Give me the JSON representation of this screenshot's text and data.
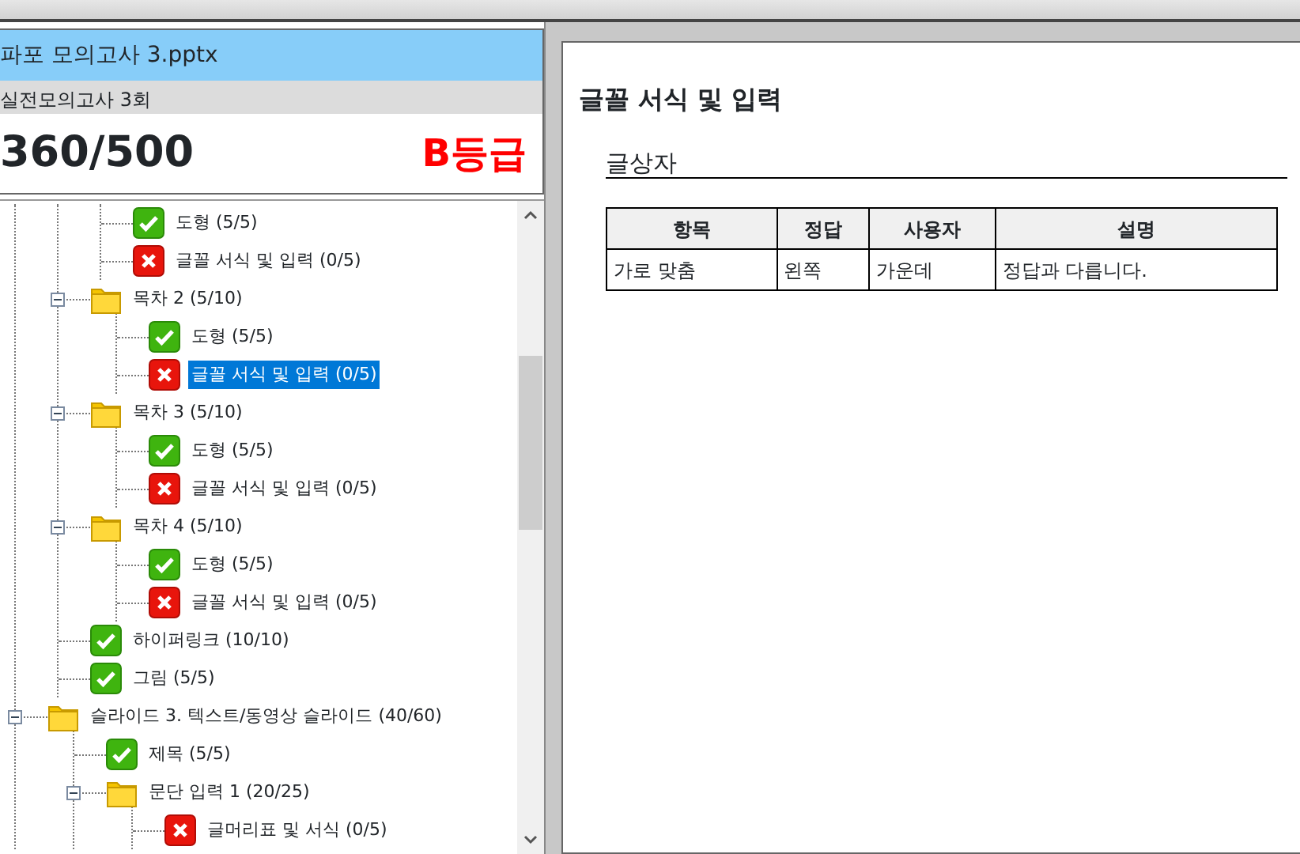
{
  "file": {
    "title": "파포 모의고사 3.pptx",
    "subtitle": "실전모의고사 3회",
    "score": "360/500",
    "grade": "B등급"
  },
  "tree": [
    {
      "kind": "continued",
      "children": [
        {
          "kind": "continued",
          "children": [
            {
              "kind": "pass",
              "label": "도형 (5/5)",
              "selected": false
            },
            {
              "kind": "fail",
              "label": "글꼴 서식 및 입력 (0/5)",
              "selected": false
            }
          ]
        },
        {
          "kind": "folder",
          "label": "목차 2 (5/10)",
          "expanded": true,
          "selected": false,
          "children": [
            {
              "kind": "pass",
              "label": "도형 (5/5)",
              "selected": false
            },
            {
              "kind": "fail",
              "label": "글꼴 서식 및 입력 (0/5)",
              "selected": true
            }
          ]
        },
        {
          "kind": "folder",
          "label": "목차 3 (5/10)",
          "expanded": true,
          "selected": false,
          "children": [
            {
              "kind": "pass",
              "label": "도형 (5/5)",
              "selected": false
            },
            {
              "kind": "fail",
              "label": "글꼴 서식 및 입력 (0/5)",
              "selected": false
            }
          ]
        },
        {
          "kind": "folder",
          "label": "목차 4 (5/10)",
          "expanded": true,
          "selected": false,
          "children": [
            {
              "kind": "pass",
              "label": "도형 (5/5)",
              "selected": false
            },
            {
              "kind": "fail",
              "label": "글꼴 서식 및 입력 (0/5)",
              "selected": false
            }
          ]
        },
        {
          "kind": "pass",
          "label": "하이퍼링크 (10/10)",
          "selected": false
        },
        {
          "kind": "pass",
          "label": "그림 (5/5)",
          "selected": false
        }
      ]
    },
    {
      "kind": "folder",
      "label": "슬라이드 3. 텍스트/동영상 슬라이드 (40/60)",
      "expanded": true,
      "selected": false,
      "children": [
        {
          "kind": "pass",
          "label": "제목 (5/5)",
          "selected": false
        },
        {
          "kind": "folder",
          "label": "문단 입력 1 (20/25)",
          "expanded": true,
          "selected": false,
          "children": [
            {
              "kind": "fail",
              "label": "글머리표 및 서식 (0/5)",
              "selected": false
            }
          ]
        }
      ]
    }
  ],
  "detail": {
    "title": "글꼴 서식 및 입력",
    "section": "글상자",
    "table": {
      "columns": [
        "항목",
        "정답",
        "사용자",
        "설명"
      ],
      "rows": [
        [
          "가로 맞춤",
          "왼쪽",
          "가운데",
          "정답과 다릅니다."
        ]
      ]
    }
  }
}
